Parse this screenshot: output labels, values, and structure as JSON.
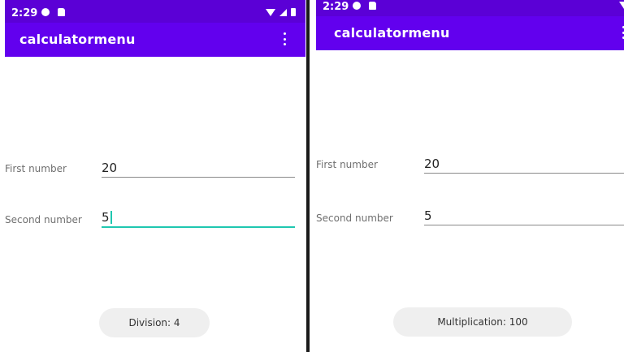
{
  "left": {
    "status": {
      "time": "2:29"
    },
    "app_bar": {
      "title": "calculatormenu"
    },
    "first_field": {
      "label": "First number",
      "value": "20"
    },
    "second_field": {
      "label": "Second number",
      "value": "5"
    },
    "result": {
      "text": "Division: 4"
    }
  },
  "right": {
    "status": {
      "time": "2:29"
    },
    "app_bar": {
      "title": "calculatormenu"
    },
    "first_field": {
      "label": "First number",
      "value": "20"
    },
    "second_field": {
      "label": "Second number",
      "value": "5"
    },
    "result": {
      "text": "Multiplication: 100"
    }
  },
  "colors": {
    "status_bar": "#5b00d6",
    "app_bar": "#6200ee",
    "focus_accent": "#1fc7b0",
    "chip_background": "#efefef"
  },
  "icons": [
    "data-saver-icon",
    "sd-card-icon",
    "wifi-icon",
    "signal-icon",
    "battery-icon",
    "more-vert-icon"
  ]
}
